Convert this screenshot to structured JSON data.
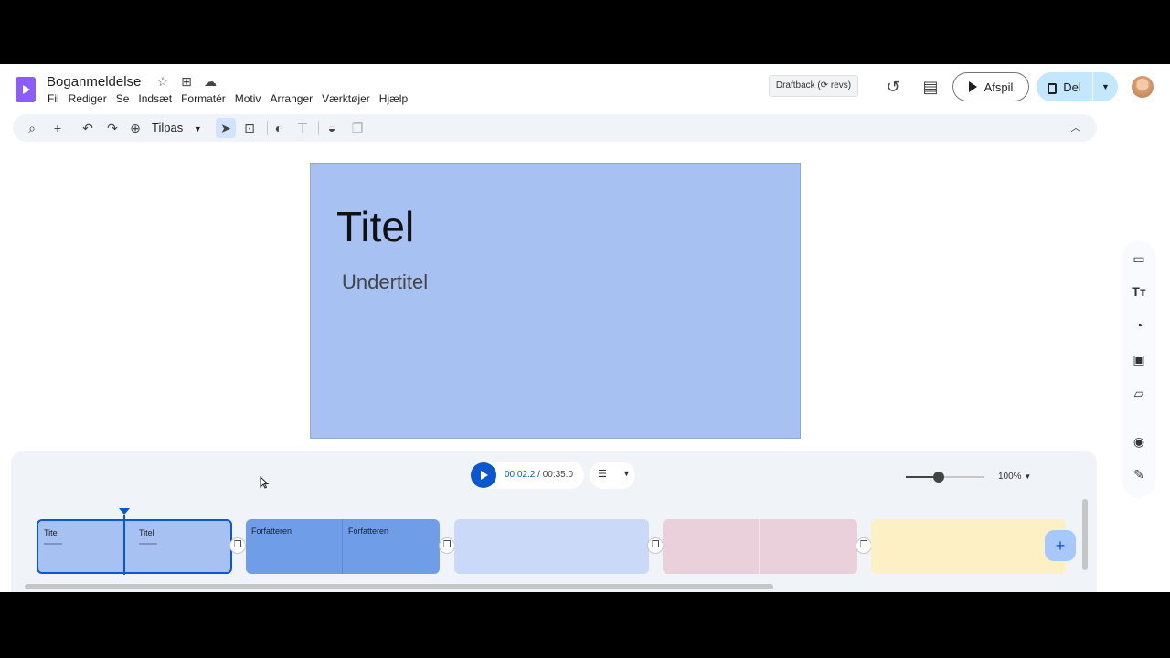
{
  "document": {
    "title": "Boganmeldelse"
  },
  "menu": [
    "Fil",
    "Rediger",
    "Se",
    "Indsæt",
    "Formatér",
    "Motiv",
    "Arranger",
    "Værktøjer",
    "Hjælp"
  ],
  "header": {
    "draftback": "Draftback (⟳ revs)",
    "play_label": "Afspil",
    "share_label": "Del"
  },
  "toolbar": {
    "zoom_label": "Tilpas"
  },
  "slide": {
    "title": "Titel",
    "subtitle": "Undertitel",
    "bg_color": "#a8c1f3"
  },
  "timeline": {
    "current_time": "00:02.2",
    "separator": " / ",
    "total_time": "00:35.0",
    "zoom": "100%",
    "clips": [
      {
        "left_label": "Titel",
        "right_label": "Titel",
        "color": "#a8c1f3",
        "selected": true
      },
      {
        "left_label": "Forfatteren",
        "right_label": "Forfatteren",
        "color": "#6f9de8"
      },
      {
        "left_label": "",
        "right_label": "",
        "color": "#c9d9f7"
      },
      {
        "left_label": "",
        "right_label": "",
        "color": "#ead0db"
      },
      {
        "left_label": "",
        "right_label": "",
        "color": "#fdf0c4"
      }
    ]
  },
  "colors": {
    "accent": "#0b57d0",
    "share_bg": "#c2e7ff",
    "logo": "#8b5cf6"
  }
}
